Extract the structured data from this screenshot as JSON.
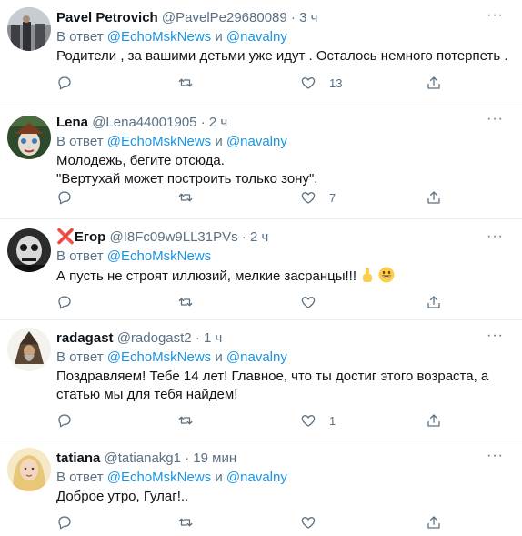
{
  "tweets": [
    {
      "name": "Pavel Petrovich",
      "handle": "@PavelPe29680089",
      "dot": "·",
      "time": "3 ч",
      "reply_prefix": "В ответ",
      "reply_user1": "@EchoMskNews",
      "reply_and": "и",
      "reply_user2": "@navalny",
      "lines": [
        "Родители , за вашими детьми уже идут . Осталось немного потерпеть ."
      ],
      "likes": "13"
    },
    {
      "name": "Lena",
      "handle": "@Lena44001905",
      "dot": "·",
      "time": "2 ч",
      "reply_prefix": "В ответ",
      "reply_user1": "@EchoMskNews",
      "reply_and": "и",
      "reply_user2": "@navalny",
      "lines": [
        "Молодежь, бегите отсюда.",
        "\"Вертухай может построить только зону\"."
      ],
      "likes": "7"
    },
    {
      "name_mark": "❌",
      "name": "Егор",
      "handle": "@I8Fc09w9LL31PVs",
      "dot": "·",
      "time": "2 ч",
      "reply_prefix": "В ответ",
      "reply_user1": "@EchoMskNews",
      "lines": [
        "А пусть не строят иллюзий, мелкие засранцы!!! "
      ],
      "likes": ""
    },
    {
      "name": "radagast",
      "handle": "@radogast2",
      "dot": "·",
      "time": "1 ч",
      "reply_prefix": "В ответ",
      "reply_user1": "@EchoMskNews",
      "reply_and": "и",
      "reply_user2": "@navalny",
      "lines": [
        "Поздравляем! Тебе 14 лет! Главное, что ты достиг этого возраста, а",
        "статью мы для тебя найдем!"
      ],
      "likes": "1"
    },
    {
      "name": "tatiana",
      "handle": "@tatianakg1",
      "dot": "·",
      "time": "19 мин",
      "reply_prefix": "В ответ",
      "reply_user1": "@EchoMskNews",
      "reply_and": "и",
      "reply_user2": "@navalny",
      "lines": [
        "Доброе утро, Гулаг!.."
      ],
      "likes": ""
    }
  ],
  "icons": {
    "reply": "reply-icon",
    "retweet": "retweet-icon",
    "like": "heart-icon",
    "share": "share-icon",
    "more": "more-icon"
  },
  "colors": {
    "link": "#1b95e0",
    "secondary": "#5b7083",
    "text": "#0f1419"
  }
}
